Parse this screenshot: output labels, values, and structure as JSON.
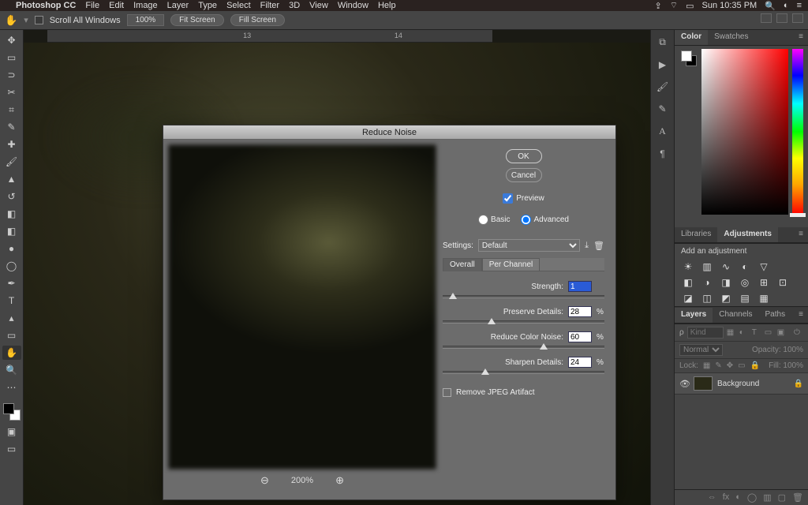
{
  "menubar": {
    "apple": "",
    "app": "Photoshop CC",
    "items": [
      "File",
      "Edit",
      "Image",
      "Layer",
      "Type",
      "Select",
      "Filter",
      "3D",
      "View",
      "Window",
      "Help"
    ],
    "status_time": "Sun 10:35 PM"
  },
  "options_bar": {
    "scroll_all_label": "Scroll All Windows",
    "zoom_pct": "100%",
    "fit_screen": "Fit Screen",
    "fill_screen": "Fill Screen"
  },
  "ruler": {
    "mark_a": "13",
    "mark_b": "14"
  },
  "dialog": {
    "title": "Reduce Noise",
    "ok": "OK",
    "cancel": "Cancel",
    "preview_label": "Preview",
    "preview_checked": true,
    "mode_basic": "Basic",
    "mode_advanced": "Advanced",
    "mode_selected": "advanced",
    "settings_label": "Settings:",
    "settings_value": "Default",
    "subtabs": {
      "overall": "Overall",
      "per_channel": "Per Channel",
      "active": "overall"
    },
    "sliders": {
      "strength": {
        "label": "Strength:",
        "value": "1",
        "pct": "",
        "pos": 4
      },
      "preserve_details": {
        "label": "Preserve Details:",
        "value": "28",
        "pct": "%",
        "pos": 28
      },
      "reduce_color": {
        "label": "Reduce Color Noise:",
        "value": "60",
        "pct": "%",
        "pos": 60
      },
      "sharpen_details": {
        "label": "Sharpen Details:",
        "value": "24",
        "pct": "%",
        "pos": 24
      }
    },
    "remove_jpeg_label": "Remove JPEG Artifact",
    "remove_jpeg_checked": false,
    "preview_zoom": "200%"
  },
  "panels": {
    "color_tab": "Color",
    "swatches_tab": "Swatches",
    "libraries_tab": "Libraries",
    "adjustments_tab": "Adjustments",
    "add_adjustment": "Add an adjustment",
    "layers_tab": "Layers",
    "channels_tab": "Channels",
    "paths_tab": "Paths",
    "kind_placeholder": "Kind",
    "blend_mode": "Normal",
    "opacity_label": "Opacity:",
    "opacity_value": "100%",
    "lock_label": "Lock:",
    "fill_label": "Fill:",
    "fill_value": "100%",
    "layer_name": "Background"
  }
}
